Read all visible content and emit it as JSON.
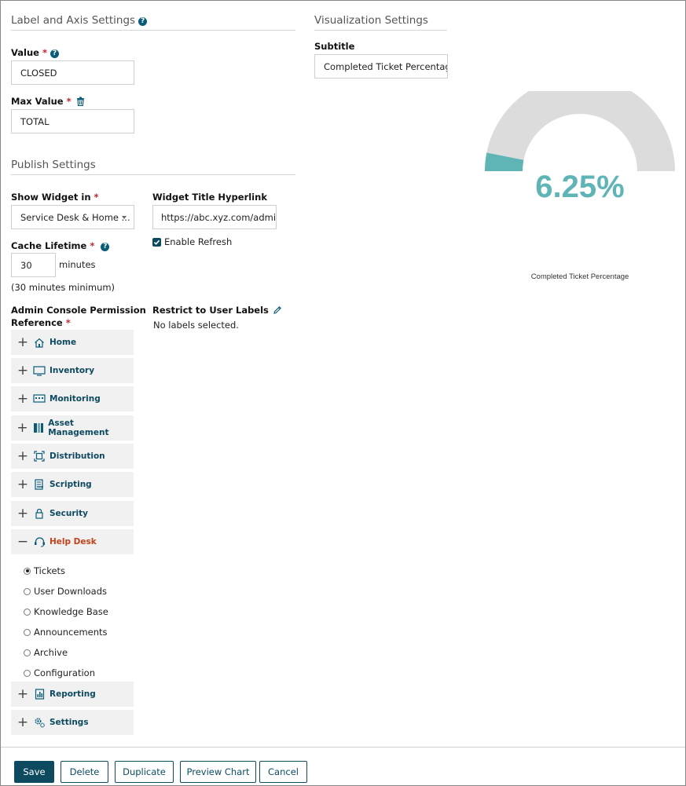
{
  "label_axis": {
    "title": "Label and Axis Settings",
    "value_label": "Value",
    "value": "CLOSED",
    "max_value_label": "Max Value",
    "max_value": "TOTAL"
  },
  "visualization": {
    "title": "Visualization Settings",
    "subtitle_label": "Subtitle",
    "subtitle_value": "Completed Ticket Percentage"
  },
  "publish": {
    "title": "Publish Settings",
    "show_widget_label": "Show Widget in",
    "show_widget_value": "Service Desk & Home ...",
    "hyperlink_label": "Widget Title Hyperlink",
    "hyperlink_value": "https://abc.xyz.com/admin",
    "enable_refresh": "Enable Refresh",
    "cache_label": "Cache Lifetime",
    "cache_value": "30",
    "cache_unit": "minutes",
    "cache_note": "(30 minutes minimum)",
    "permission_label_line1": "Admin Console Permission",
    "permission_label_line2": "Reference",
    "restrict_label": "Restrict to User Labels",
    "no_labels": "No labels selected."
  },
  "permissions": [
    {
      "label": "Home",
      "icon": "home-icon",
      "expanded": false
    },
    {
      "label": "Inventory",
      "icon": "monitor-icon",
      "expanded": false
    },
    {
      "label": "Monitoring",
      "icon": "monitoring-icon",
      "expanded": false
    },
    {
      "label": "Asset Management",
      "icon": "asset-icon",
      "expanded": false
    },
    {
      "label": "Distribution",
      "icon": "distribution-icon",
      "expanded": false
    },
    {
      "label": "Scripting",
      "icon": "scripting-icon",
      "expanded": false
    },
    {
      "label": "Security",
      "icon": "lock-icon",
      "expanded": false
    },
    {
      "label": "Help Desk",
      "icon": "headset-icon",
      "expanded": true
    },
    {
      "label": "Reporting",
      "icon": "reporting-icon",
      "expanded": false
    },
    {
      "label": "Settings",
      "icon": "gears-icon",
      "expanded": false
    }
  ],
  "helpdesk_options": [
    {
      "label": "Tickets",
      "selected": true
    },
    {
      "label": "User Downloads",
      "selected": false
    },
    {
      "label": "Knowledge Base",
      "selected": false
    },
    {
      "label": "Announcements",
      "selected": false
    },
    {
      "label": "Archive",
      "selected": false
    },
    {
      "label": "Configuration",
      "selected": false
    }
  ],
  "gauge": {
    "value_text": "6.25%",
    "fraction": 0.0625,
    "caption": "Completed Ticket Percentage",
    "fill_color": "#5fb5b6",
    "track_color": "#dcdcdc"
  },
  "buttons": {
    "save": "Save",
    "delete": "Delete",
    "duplicate": "Duplicate",
    "preview": "Preview Chart",
    "cancel": "Cancel"
  },
  "colors": {
    "accent": "#0d4a60",
    "required": "#c0282b",
    "active_item": "#c4421b"
  }
}
